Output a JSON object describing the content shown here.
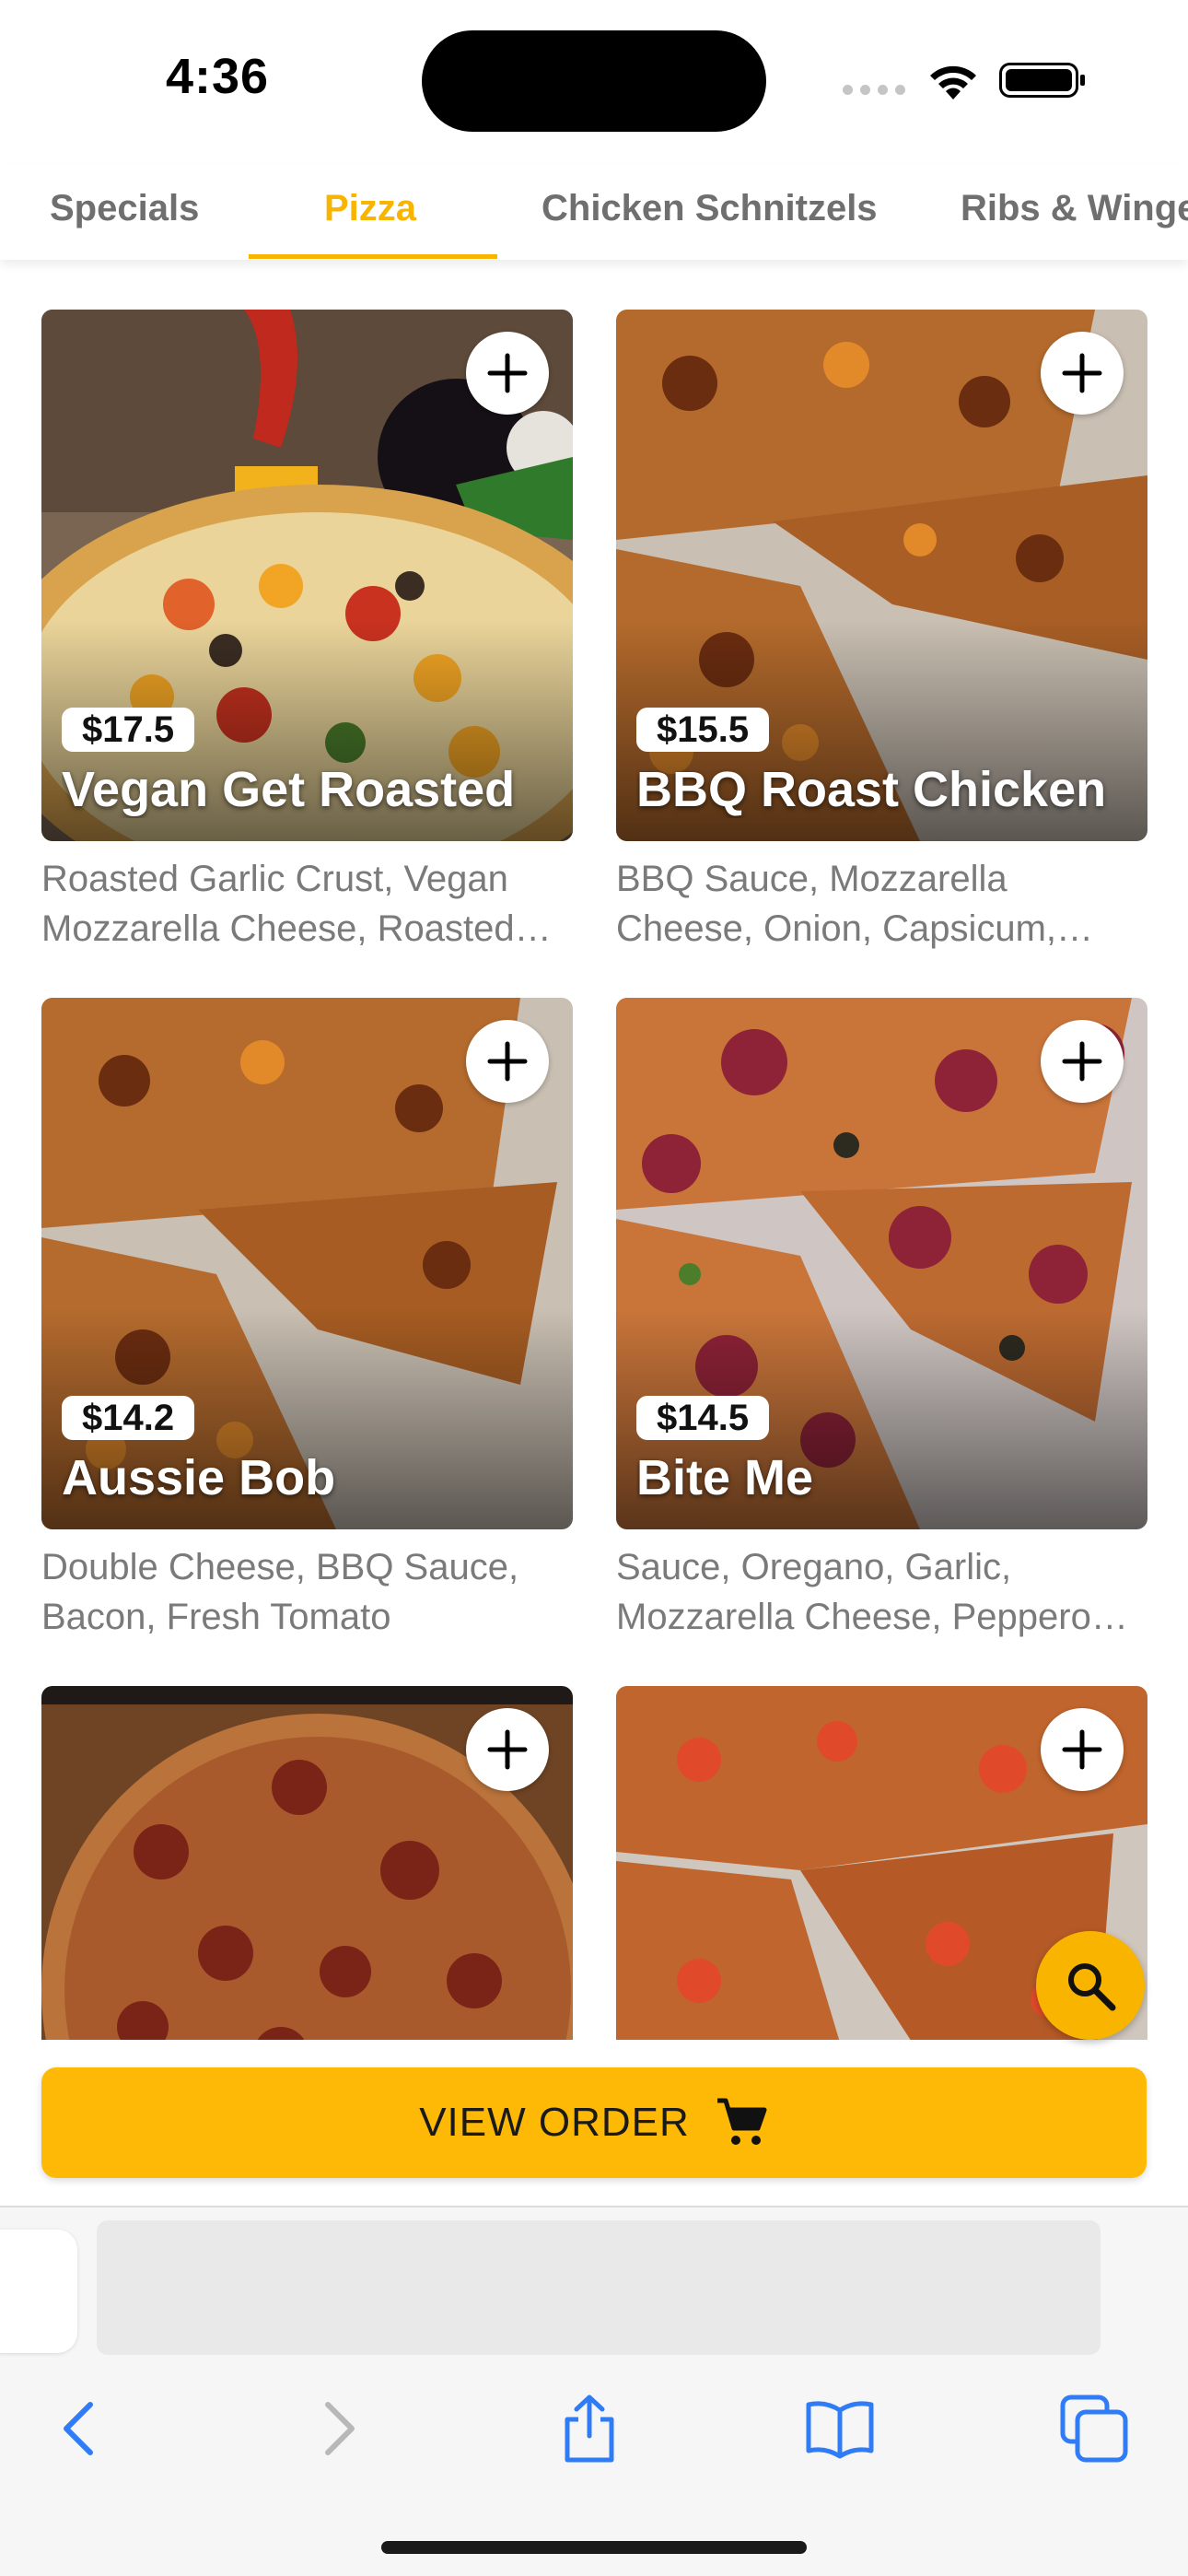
{
  "status_bar": {
    "time": "4:36"
  },
  "tabs": [
    {
      "label": "Specials",
      "active": false
    },
    {
      "label": "Pizza",
      "active": true
    },
    {
      "label": "Chicken Schnitzels",
      "active": false
    },
    {
      "label": "Ribs & Winge",
      "active": false
    }
  ],
  "products": [
    {
      "price": "$17.5",
      "name": "Vegan Get Roasted",
      "description": "Roasted Garlic Crust, Vegan Mozzarella Cheese, Roasted…"
    },
    {
      "price": "$15.5",
      "name": "BBQ Roast Chicken",
      "description": "BBQ Sauce, Mozzarella Cheese, Onion, Capsicum,…"
    },
    {
      "price": "$14.2",
      "name": "Aussie Bob",
      "description": "Double Cheese, BBQ Sauce, Bacon, Fresh Tomato"
    },
    {
      "price": "$14.5",
      "name": "Bite Me",
      "description": "Sauce, Oregano, Garlic, Mozzarella Cheese, Peppero…"
    },
    {
      "price": "",
      "name": "",
      "description": ""
    },
    {
      "price": "",
      "name": "",
      "description": ""
    }
  ],
  "order_bar": {
    "label": "VIEW ORDER",
    "icon": "cart-icon"
  },
  "colors": {
    "accent": "#f9b400",
    "order_bar": "#fdb905",
    "browser_tint": "#2f7cf6"
  },
  "browser_toolbar": {
    "buttons": [
      "back-icon",
      "forward-icon",
      "share-icon",
      "bookmarks-icon",
      "tabs-icon"
    ]
  }
}
